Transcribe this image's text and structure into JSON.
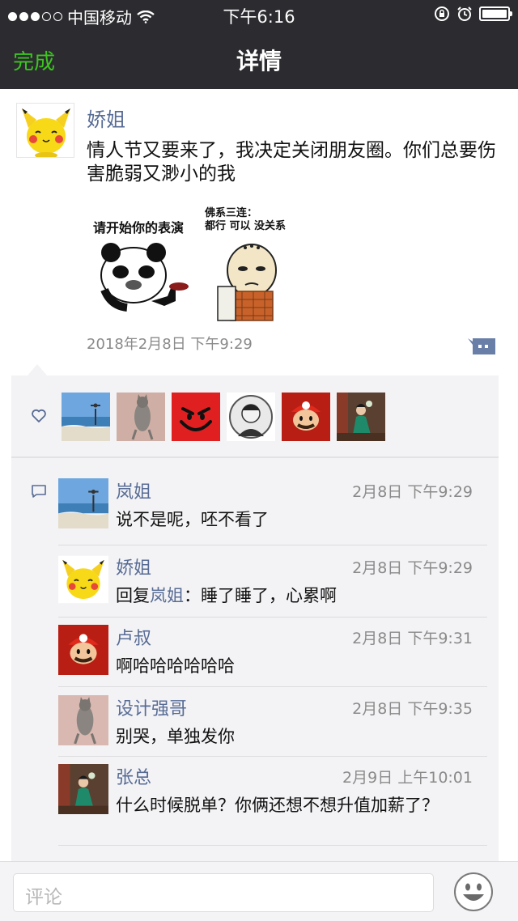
{
  "status_bar": {
    "carrier": "中国移动",
    "time": "下午6:16"
  },
  "nav": {
    "done_label": "完成",
    "title": "详情"
  },
  "post": {
    "author": "娇姐",
    "text": "情人节又要来了，我决定关闭朋友圈。你们总要伤害脆弱又渺小的我",
    "image_caption_left": "请开始你的表演",
    "image_caption_right_line1": "佛系三连：",
    "image_caption_right_line2": "都行 可以 没关系",
    "timestamp": "2018年2月8日  下午9:29"
  },
  "likes": {
    "icon": "heart-outline-icon",
    "avatars": [
      "beach-avatar",
      "cat-avatar",
      "red-devil-smile-avatar",
      "portrait-avatar",
      "mario-avatar",
      "woman-seated-avatar"
    ]
  },
  "comments": [
    {
      "name": "岚姐",
      "time": "2月8日  下午9:29",
      "text": "说不是呢，呸不看了",
      "avatar": "beach-avatar"
    },
    {
      "name": "娇姐",
      "time": "2月8日  下午9:29",
      "reply_prefix": "回复",
      "reply_to": "岚姐",
      "text": "：睡了睡了，心累啊",
      "avatar": "pikachu-avatar"
    },
    {
      "name": "卢叔",
      "time": "2月8日  下午9:31",
      "text": "啊哈哈哈哈哈哈",
      "avatar": "mario-avatar"
    },
    {
      "name": "设计强哥",
      "time": "2月8日  下午9:35",
      "text": "别哭，单独发你",
      "avatar": "cat-avatar"
    },
    {
      "name": "张总",
      "time": "2月9日  上午10:01",
      "text": "什么时候脱单？你俩还想不想升值加薪了？",
      "avatar": "woman-seated-avatar"
    }
  ],
  "input": {
    "placeholder": "评论"
  },
  "colors": {
    "nav_bg": "#2c2c30",
    "done_green": "#3cc51f",
    "link_blue": "#576b95",
    "panel_bg": "#f3f3f5"
  }
}
